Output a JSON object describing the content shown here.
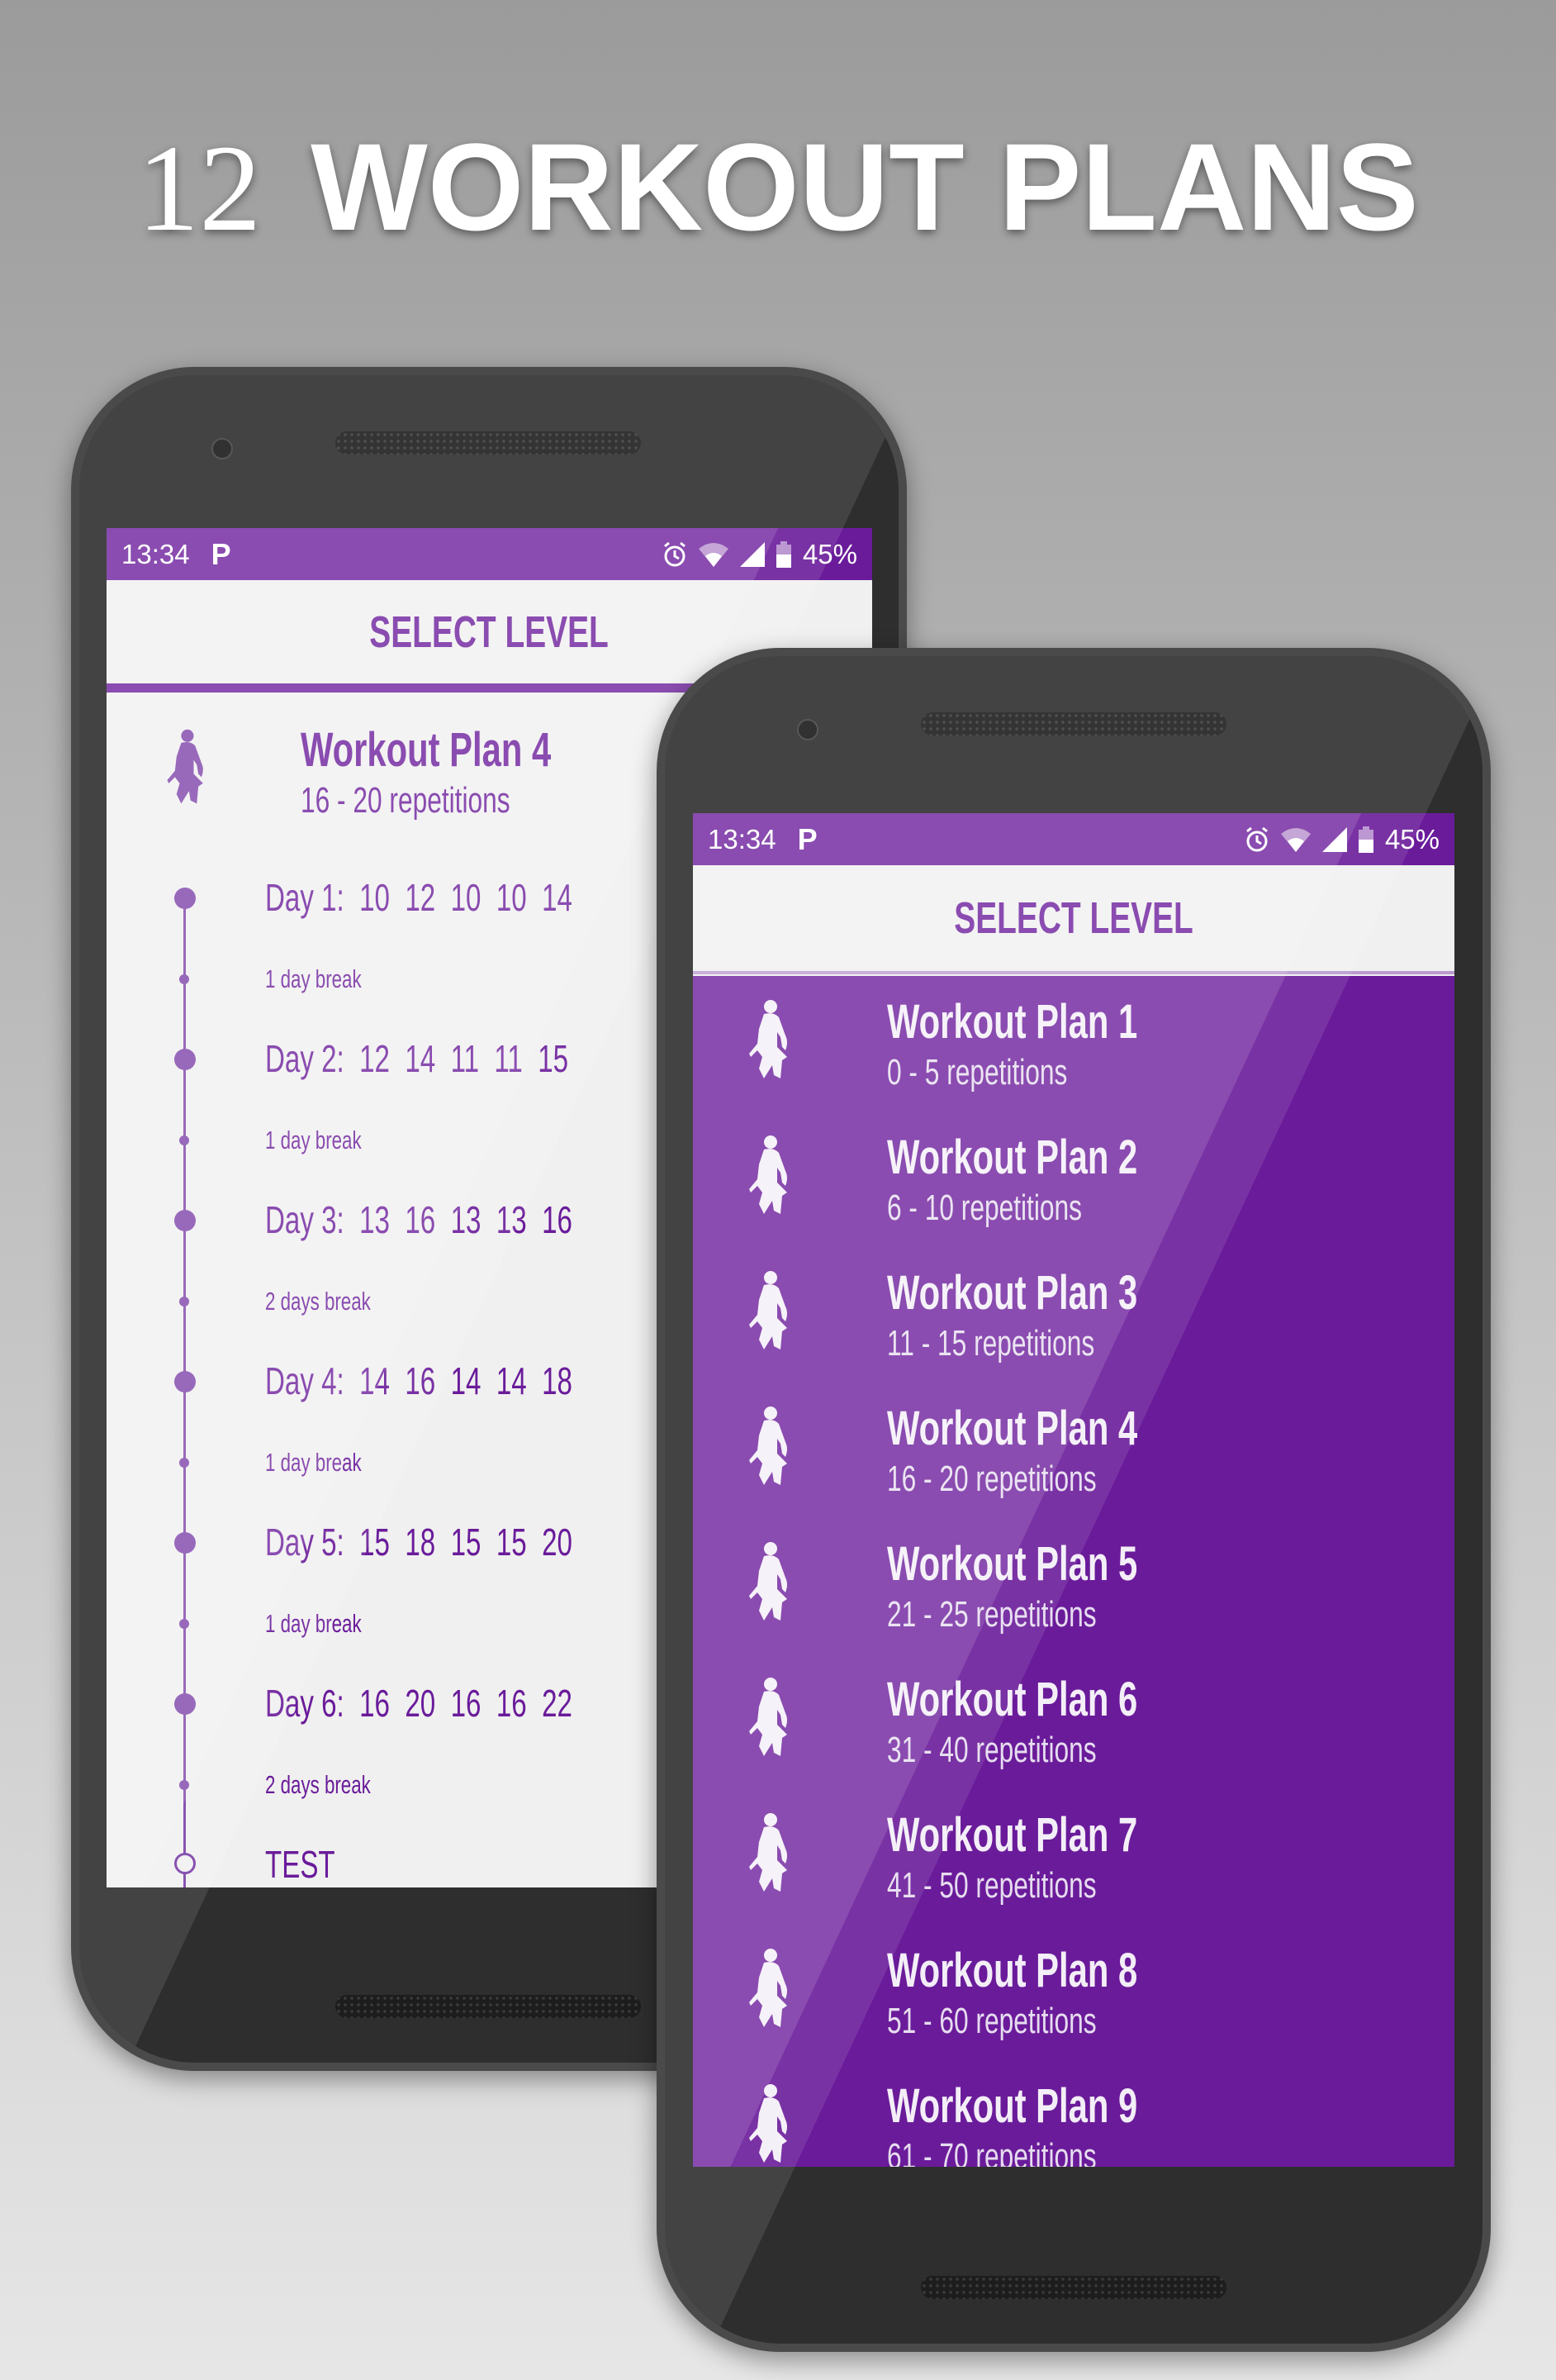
{
  "hero": {
    "number": "12",
    "title": "WORKOUT PLANS"
  },
  "colors": {
    "accent": "#6a1b9a",
    "accent_light": "#7b3fa8",
    "screen_bg": "#f0f0f0"
  },
  "status_bar": {
    "time": "13:34",
    "notification": "P",
    "battery": "45%",
    "icons": [
      "alarm-icon",
      "wifi-icon",
      "signal-icon",
      "battery-icon"
    ]
  },
  "back_screen": {
    "header": "SELECT LEVEL",
    "plan": {
      "title": "Workout Plan 4",
      "subtitle": "16 - 20 repetitions",
      "icon": "athlete-icon"
    },
    "timeline": [
      {
        "day": "Day 1:",
        "reps": "10  12  10  10  14",
        "break": "1 day break"
      },
      {
        "day": "Day 2:",
        "reps": "12  14  11  11  15",
        "break": "1 day break"
      },
      {
        "day": "Day 3:",
        "reps": "13  16  13  13  16",
        "break": "2 days break"
      },
      {
        "day": "Day 4:",
        "reps": "14  16  14  14  18",
        "break": "1 day break"
      },
      {
        "day": "Day 5:",
        "reps": "15  18  15  15  20",
        "break": "1 day break"
      },
      {
        "day": "Day 6:",
        "reps": "16  20  16  16  22",
        "break": "2 days break"
      }
    ],
    "test_label": "TEST"
  },
  "front_screen": {
    "header": "SELECT LEVEL",
    "plans": [
      {
        "title": "Workout Plan 1",
        "subtitle": "0 - 5 repetitions"
      },
      {
        "title": "Workout Plan 2",
        "subtitle": "6 - 10 repetitions"
      },
      {
        "title": "Workout Plan 3",
        "subtitle": "11 - 15 repetitions"
      },
      {
        "title": "Workout Plan 4",
        "subtitle": "16 - 20 repetitions"
      },
      {
        "title": "Workout Plan 5",
        "subtitle": "21 - 25 repetitions"
      },
      {
        "title": "Workout Plan 6",
        "subtitle": "31 - 40 repetitions"
      },
      {
        "title": "Workout Plan 7",
        "subtitle": "41 - 50 repetitions"
      },
      {
        "title": "Workout Plan 8",
        "subtitle": "51 - 60 repetitions"
      },
      {
        "title": "Workout Plan 9",
        "subtitle": "61 - 70 repetitions"
      }
    ]
  }
}
